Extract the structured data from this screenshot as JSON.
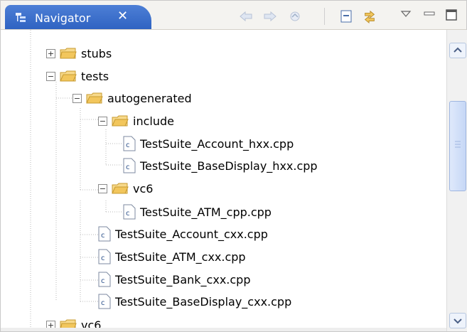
{
  "window": {
    "tab_title": "Navigator"
  },
  "toolbar": {
    "icons": [
      "back-arrow-icon",
      "forward-arrow-icon",
      "up-icon",
      "collapse-all-icon",
      "link-editor-icon",
      "view-menu-icon",
      "minimize-icon",
      "maximize-icon"
    ]
  },
  "tree": {
    "items": [
      {
        "label": "stubs",
        "type": "folder",
        "expanded": false
      },
      {
        "label": "tests",
        "type": "folder",
        "expanded": true
      },
      {
        "label": "autogenerated",
        "type": "folder",
        "expanded": true
      },
      {
        "label": "include",
        "type": "folder",
        "expanded": true
      },
      {
        "label": "TestSuite_Account_hxx.cpp",
        "type": "file"
      },
      {
        "label": "TestSuite_BaseDisplay_hxx.cpp",
        "type": "file"
      },
      {
        "label": "vc6",
        "type": "folder",
        "expanded": true
      },
      {
        "label": "TestSuite_ATM_cpp.cpp",
        "type": "file"
      },
      {
        "label": "TestSuite_Account_cxx.cpp",
        "type": "file"
      },
      {
        "label": "TestSuite_ATM_cxx.cpp",
        "type": "file"
      },
      {
        "label": "TestSuite_Bank_cxx.cpp",
        "type": "file"
      },
      {
        "label": "TestSuite_BaseDisplay_cxx.cpp",
        "type": "file"
      },
      {
        "label": "vc6",
        "type": "folder",
        "expanded": false
      }
    ]
  },
  "colors": {
    "tab_blue": "#3a6fcf",
    "folder": "#f2c65c",
    "tree_line": "#b8b8b8"
  }
}
